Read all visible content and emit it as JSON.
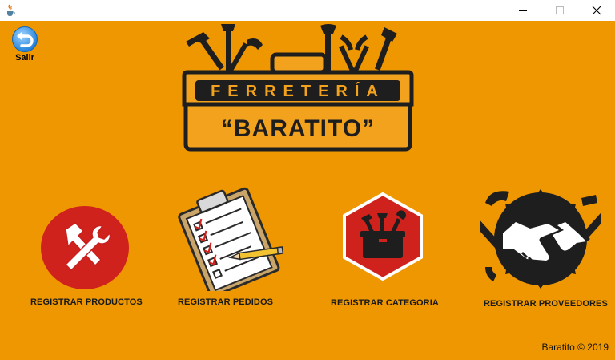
{
  "window": {
    "app_icon": "java-cup-icon",
    "controls": [
      "minimize-icon",
      "maximize-icon",
      "close-icon"
    ]
  },
  "toolbar": {
    "exit_label": "Salir",
    "exit_icon": "undo-arrow-icon"
  },
  "logo": {
    "line1": "FERRETERÍA",
    "line2": "“BARATITO”"
  },
  "menu": [
    {
      "label": "REGISTRAR PRODUCTOS",
      "icon": "hammer-wrench-icon"
    },
    {
      "label": "REGISTRAR PEDIDOS",
      "icon": "clipboard-checklist-icon"
    },
    {
      "label": "REGISTRAR CATEGORIA",
      "icon": "toolbox-icon"
    },
    {
      "label": "REGISTRAR PROVEEDORES",
      "icon": "handshake-icon"
    }
  ],
  "footer": {
    "text": "Baratito © 2019"
  },
  "colors": {
    "background": "#ef9700",
    "accent_red": "#c81e1e",
    "dark": "#222222"
  }
}
